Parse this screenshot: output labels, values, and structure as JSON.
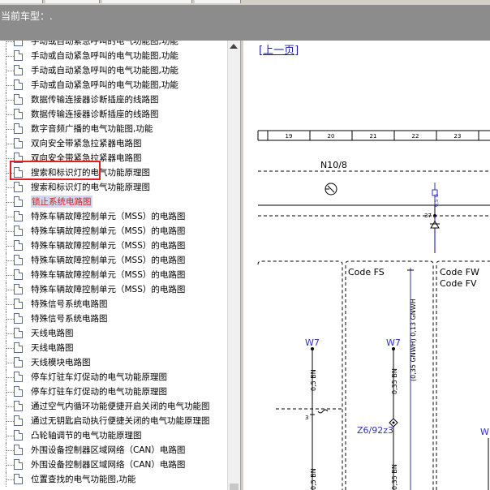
{
  "header": {
    "title": "当前车型：."
  },
  "tree": {
    "items": [
      {
        "label": "手动或自动紧急呼叫的电气功能图,功能"
      },
      {
        "label": "手动或自动紧急呼叫的电气功能图,功能"
      },
      {
        "label": "手动或自动紧急呼叫的电气功能图,功能"
      },
      {
        "label": "手动或自动紧急呼叫的电气功能图,功能"
      },
      {
        "label": "数据传输连接器诊断插座的线路图"
      },
      {
        "label": "数据传输连接器诊断插座的线路图"
      },
      {
        "label": "数字音频广播的电气功能图,功能"
      },
      {
        "label": "双向安全带紧急拉紧器电路图"
      },
      {
        "label": "双向安全带紧急拉紧器电路图"
      },
      {
        "label": "搜索和标识灯的电气功能原理图"
      },
      {
        "label": "搜索和标识灯的电气功能原理图"
      },
      {
        "label": "锁止系统电路图",
        "selected": true
      },
      {
        "label": "特殊车辆故障控制单元（MSS）的电路图"
      },
      {
        "label": "特殊车辆故障控制单元（MSS）的电路图"
      },
      {
        "label": "特殊车辆故障控制单元（MSS）的电路图"
      },
      {
        "label": "特殊车辆故障控制单元（MSS）的电路图"
      },
      {
        "label": "特殊车辆故障控制单元（MSS）的电路图"
      },
      {
        "label": "特殊车辆故障控制单元（MSS）的电路图"
      },
      {
        "label": "特殊信号系统电路图"
      },
      {
        "label": "特殊信号系统电路图"
      },
      {
        "label": "天线电路图"
      },
      {
        "label": "天线电路图"
      },
      {
        "label": "天线模块电路图"
      },
      {
        "label": "停车灯驻车灯促动的电气功能原理图"
      },
      {
        "label": "停车灯驻车灯促动的电气功能原理图"
      },
      {
        "label": "通过空气内循环功能便捷开启关闭的电气功能图"
      },
      {
        "label": "通过无钥匙启动执行便捷关闭的电气功能原理图"
      },
      {
        "label": "凸轮轴调节的电气功能原理图"
      },
      {
        "label": "外围设备控制器区域网络（CAN）电路图"
      },
      {
        "label": "外围设备控制器区域网络（CAN）电路图"
      },
      {
        "label": "位置查找的电气功能图,功能"
      }
    ]
  },
  "content": {
    "prev_link": "[上一页]",
    "grid_numbers": [
      "19",
      "20",
      "21",
      "22",
      "23"
    ],
    "component_n10": "N10/8",
    "pin_37": "37",
    "wire_vertical": "0,5 BN",
    "code_fs": "Code FS",
    "code_fw": "Code FW",
    "code_fv": "Code FV",
    "wire_gnwh": "(0,35 GNWH) 0,13 GNWH",
    "w7_a": "W7",
    "w7_b": "W7",
    "w7_partial": "W",
    "wire_bn_a": "0,5 BN",
    "wire_bn_b": "0,35 BN",
    "wire_bn_c": "0,5 BN",
    "wire_bn_d": "0,35 BN",
    "pin_3": "3",
    "z6": "Z6/92z3",
    "wire_g": "0,5 G"
  },
  "colors": {
    "header_bg": "#8c8c8c",
    "link": "#1a1aa6",
    "selection_border": "#e02020",
    "wire_blue": "#3030c0"
  }
}
